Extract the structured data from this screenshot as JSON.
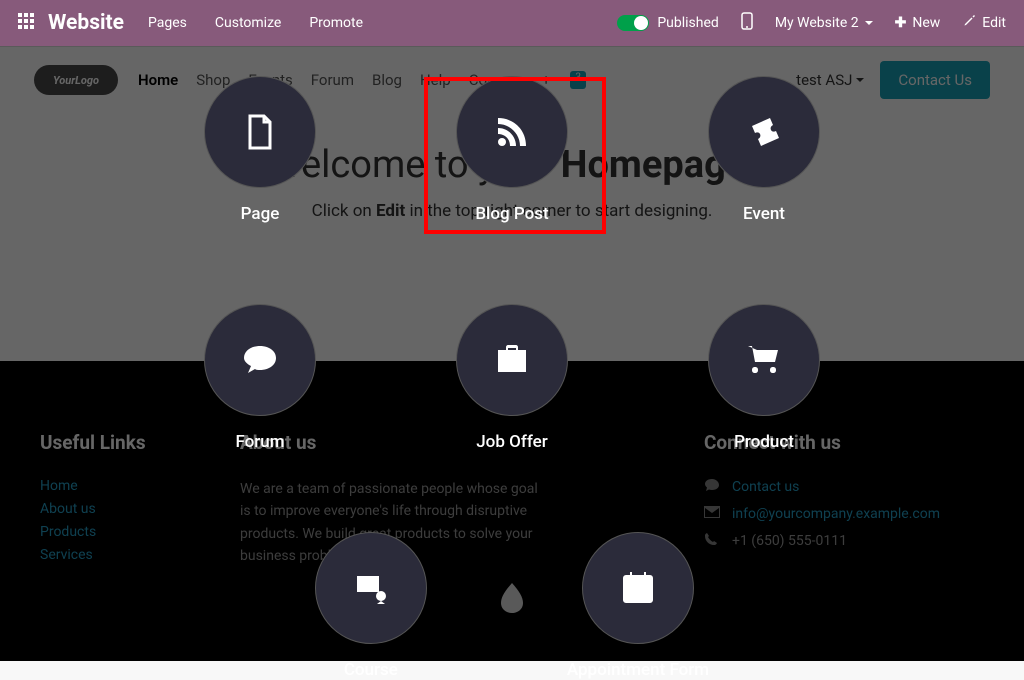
{
  "topbar": {
    "brand": "Website",
    "menu": [
      "Pages",
      "Customize",
      "Promote"
    ],
    "published": "Published",
    "site": "My Website 2",
    "new": "New",
    "edit": "Edit"
  },
  "nav": {
    "logo": "YourLogo",
    "links": [
      "Home",
      "Shop",
      "Events",
      "Forum",
      "Blog",
      "Help",
      "Courses"
    ],
    "badge": "3",
    "user": "test ASJ",
    "contact": "Contact Us"
  },
  "hero": {
    "title_pre": "Welcome to your ",
    "title_bold": "Homepage",
    "title_post": "!",
    "sub_pre": "Click on ",
    "sub_bold": "Edit",
    "sub_post": " in the top right corner to start designing."
  },
  "footer": {
    "useful_title": "Useful Links",
    "useful": [
      "Home",
      "About us",
      "Products",
      "Services"
    ],
    "about_title": "About us",
    "about_text": "We are a team of passionate people whose goal is to improve everyone's life through disruptive products. We build great products to solve your business problems.",
    "connect_title": "Connect with us",
    "contact_us": "Contact us",
    "email": "info@yourcompany.example.com",
    "phone": "+1 (650) 555-0111"
  },
  "modal": {
    "options": [
      "Page",
      "Blog Post",
      "Event",
      "Forum",
      "Job Offer",
      "Product",
      "Course",
      "Appointment Form"
    ]
  }
}
